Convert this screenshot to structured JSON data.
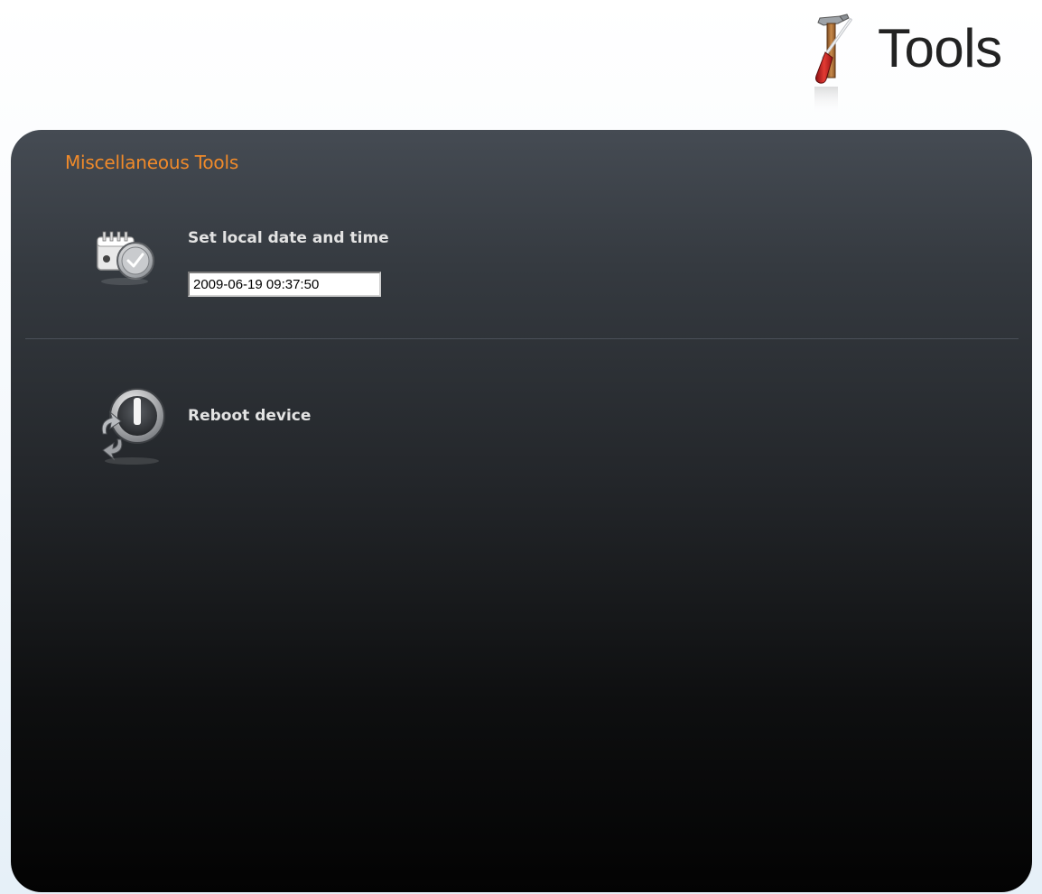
{
  "header": {
    "title": "Tools",
    "icon": "tools-icon"
  },
  "panel": {
    "heading": "Miscellaneous Tools",
    "heading_color": "#f08a2a",
    "tools": [
      {
        "label": "Set local date and time",
        "icon": "calendar-clock-icon",
        "input_value": "2009-06-19 09:37:50"
      },
      {
        "label": "Reboot device",
        "icon": "reboot-power-icon"
      }
    ]
  }
}
